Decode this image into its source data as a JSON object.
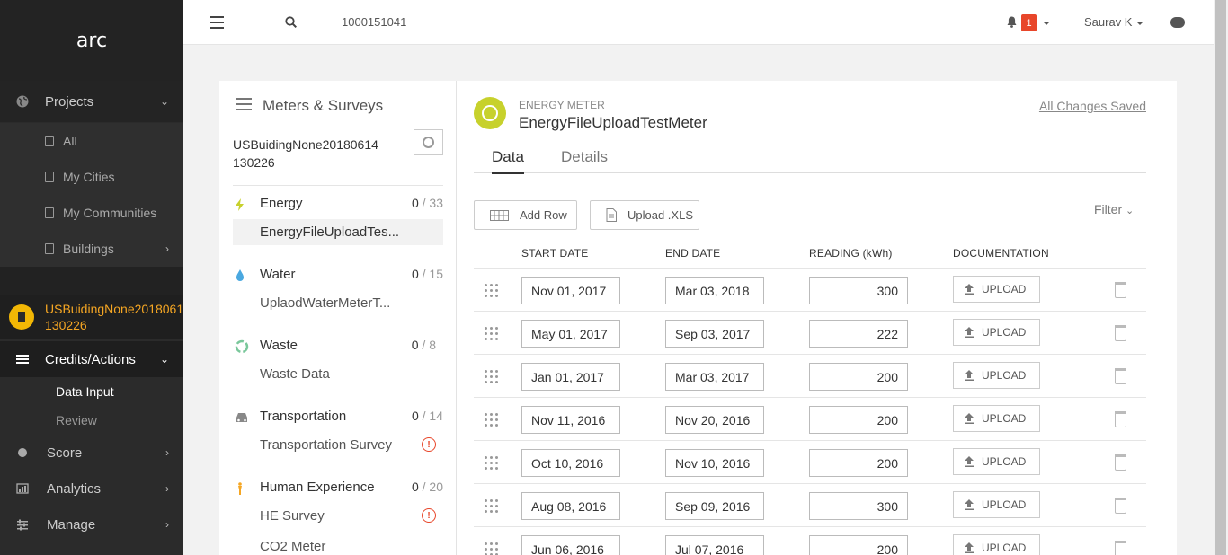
{
  "logo": "arc",
  "sidebar": {
    "projects": "Projects",
    "sub_items": [
      "All",
      "My Cities",
      "My Communities",
      "Buildings"
    ],
    "building_name_line1": "USBuidingNone2018061",
    "building_name_line2": "130226",
    "credits": "Credits/Actions",
    "data_input": "Data Input",
    "review": "Review",
    "score": "Score",
    "analytics": "Analytics",
    "manage": "Manage"
  },
  "topbar": {
    "search_value": "1000151041",
    "notification_count": "1",
    "user": "Saurav K"
  },
  "panel": {
    "title": "Meters & Surveys",
    "building_line1": "USBuidingNone20180614",
    "building_line2": "130226",
    "categories": [
      {
        "name": "Energy",
        "done": "0",
        "total": " / 33",
        "sub": "EnergyFileUploadTes..."
      },
      {
        "name": "Water",
        "done": "0",
        "total": " / 15",
        "sub": "UplaodWaterMeterT..."
      },
      {
        "name": "Waste",
        "done": "0",
        "total": " / 8",
        "sub": "Waste Data"
      },
      {
        "name": "Transportation",
        "done": "0",
        "total": " / 14",
        "sub": "Transportation Survey"
      },
      {
        "name": "Human Experience",
        "done": "0",
        "total": " / 20",
        "sub": "HE Survey"
      }
    ],
    "co2": "CO2 Meter"
  },
  "meter": {
    "type": "ENERGY METER",
    "name": "EnergyFileUploadTestMeter",
    "saved": "All Changes Saved",
    "tabs": [
      "Data",
      "Details"
    ],
    "add_row": "Add Row",
    "upload_xls": "Upload .XLS",
    "filter": "Filter",
    "columns": [
      "START DATE",
      "END DATE",
      "READING (kWh)",
      "DOCUMENTATION"
    ],
    "upload_label": "UPLOAD",
    "rows": [
      {
        "start": "Nov 01, 2017",
        "end": "Mar 03, 2018",
        "reading": "300"
      },
      {
        "start": "May 01, 2017",
        "end": "Sep 03, 2017",
        "reading": "222"
      },
      {
        "start": "Jan 01, 2017",
        "end": "Mar 03, 2017",
        "reading": "200"
      },
      {
        "start": "Nov 11, 2016",
        "end": "Nov 20, 2016",
        "reading": "200"
      },
      {
        "start": "Oct 10, 2016",
        "end": "Nov 10, 2016",
        "reading": "200"
      },
      {
        "start": "Aug 08, 2016",
        "end": "Sep 09, 2016",
        "reading": "300"
      },
      {
        "start": "Jun 06, 2016",
        "end": "Jul 07, 2016",
        "reading": "200"
      }
    ]
  },
  "colors": {
    "accent": "#f5a623",
    "badge": "#e8462a",
    "meter_icon": "#c7d12c"
  }
}
